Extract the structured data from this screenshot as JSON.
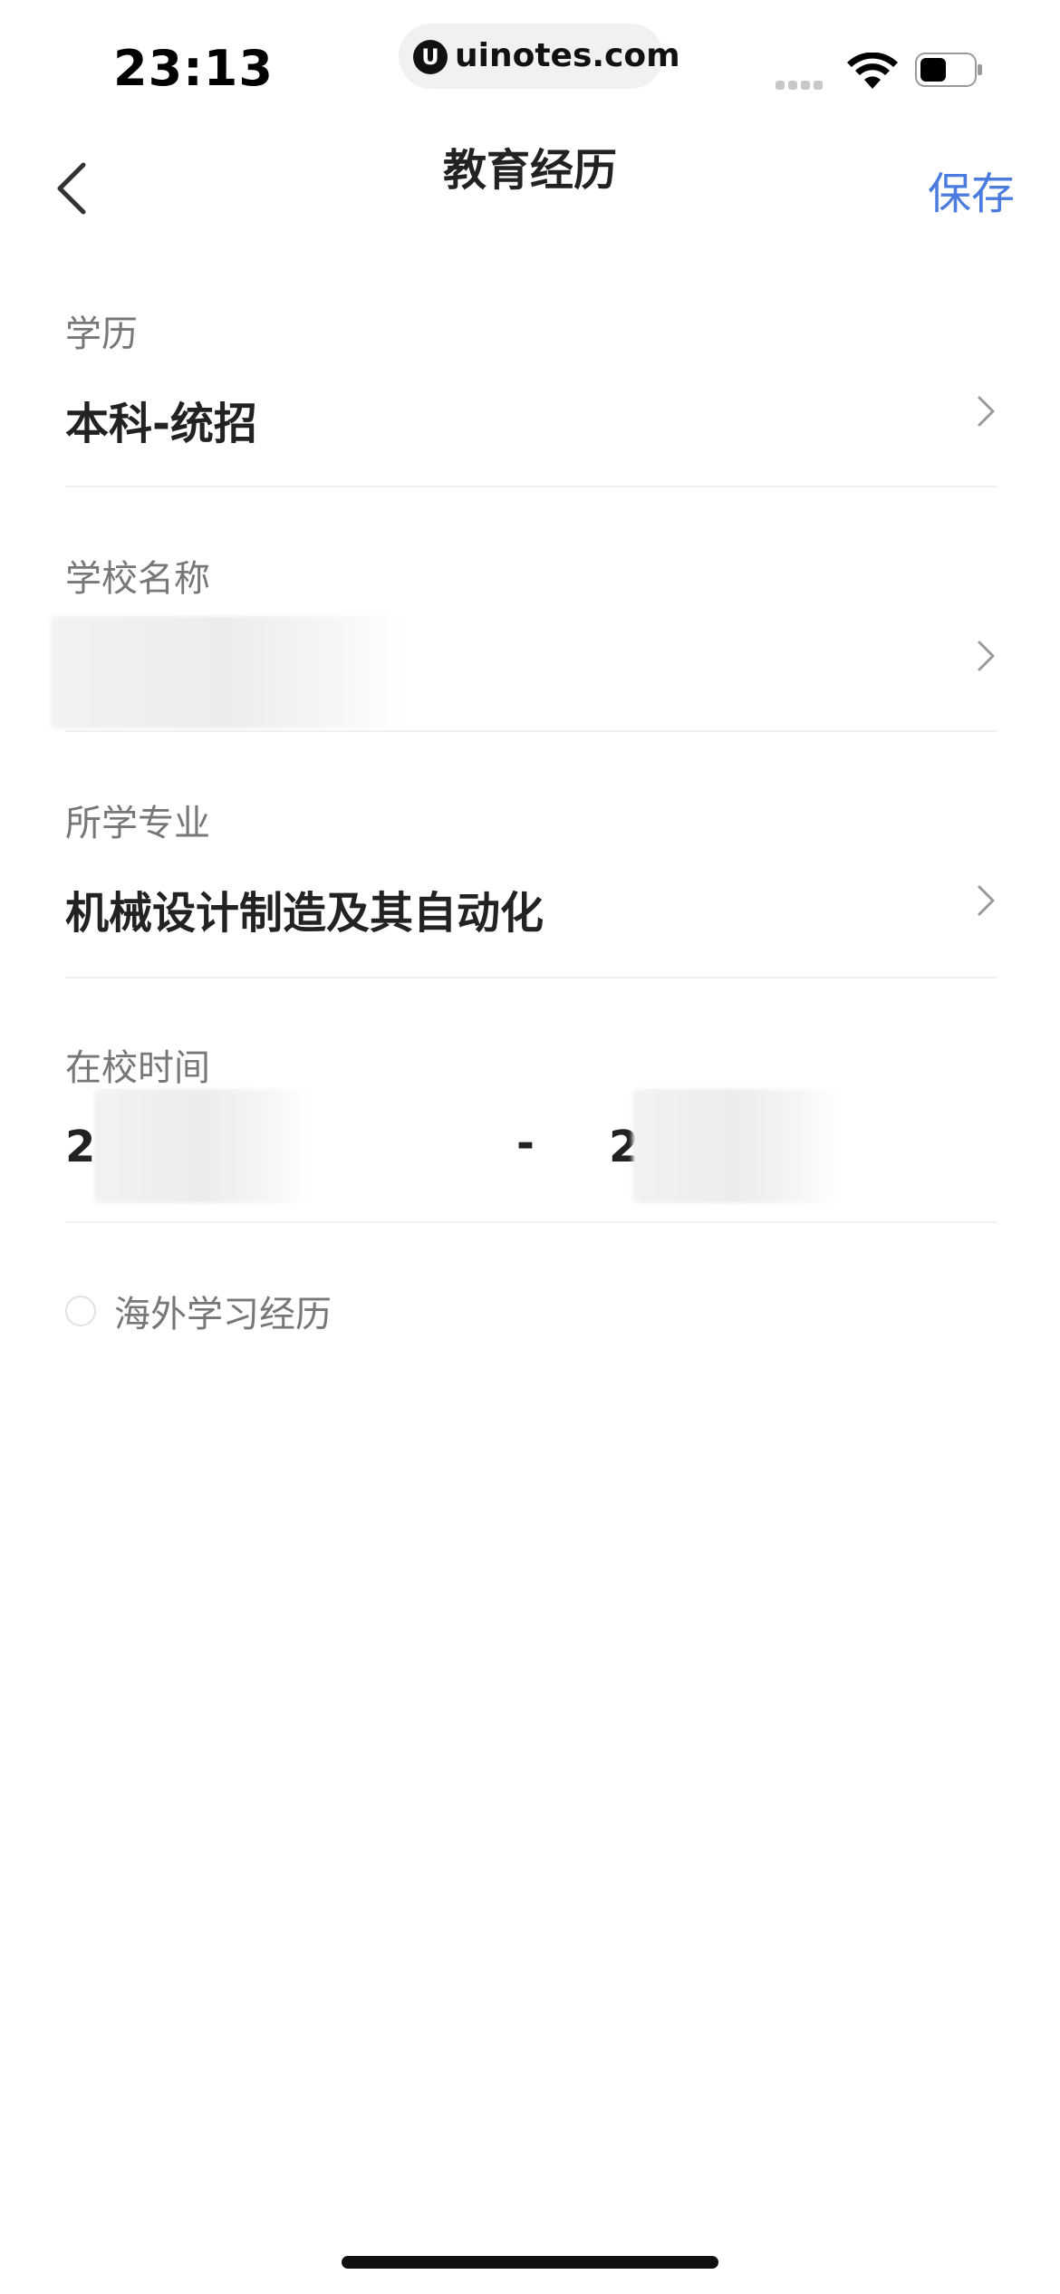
{
  "status_bar": {
    "time": "23:13",
    "url": "uinotes.com",
    "url_logo": "U"
  },
  "nav": {
    "title": "教育经历",
    "save_label": "保存",
    "back_icon": "chevron-left-icon"
  },
  "form": {
    "education_level": {
      "label": "学历",
      "value": "本科-统招"
    },
    "school_name": {
      "label": "学校名称",
      "value": ""
    },
    "major": {
      "label": "所学专业",
      "value": "机械设计制造及其自动化"
    },
    "school_time": {
      "label": "在校时间",
      "start_prefix": "2",
      "separator": "-",
      "end_prefix": "2"
    }
  },
  "overseas": {
    "label": "海外学习经历",
    "checked": false
  },
  "colors": {
    "accent": "#4a7bde",
    "text_primary": "#222222",
    "text_secondary": "#777777",
    "divider": "#f0f0f0"
  }
}
